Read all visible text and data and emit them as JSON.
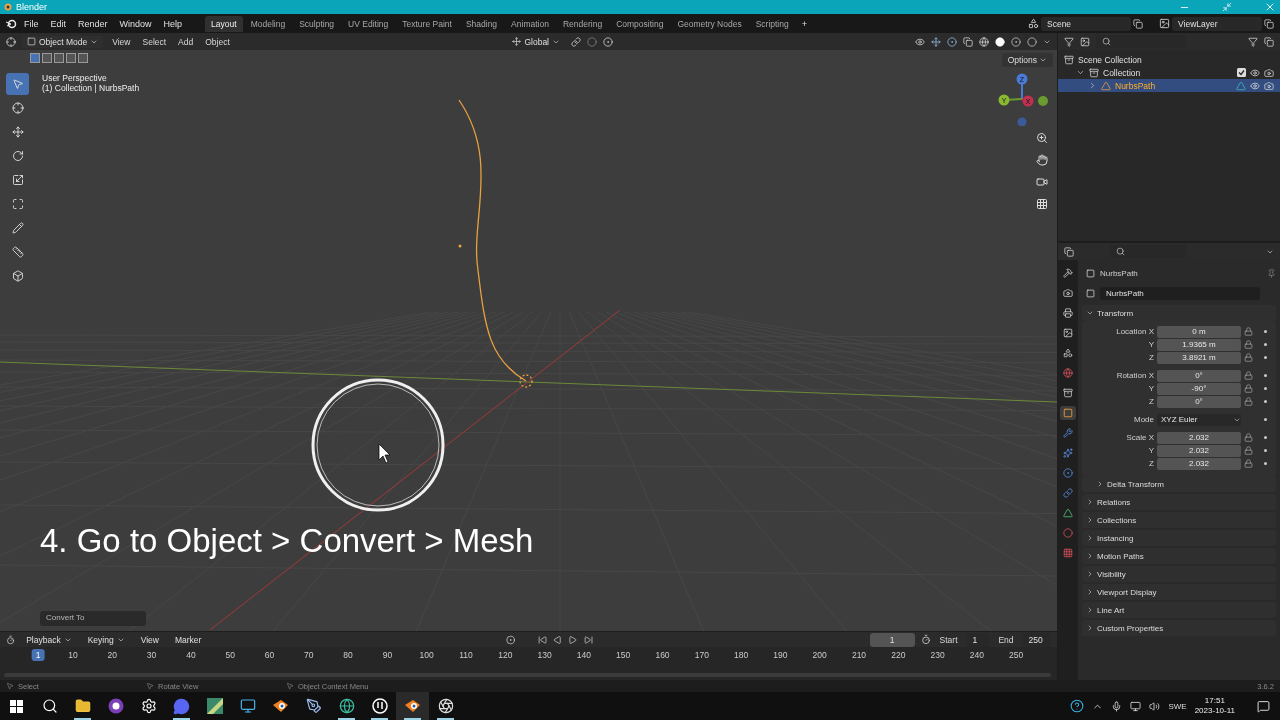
{
  "window": {
    "title": "Blender"
  },
  "menu": [
    "File",
    "Edit",
    "Render",
    "Window",
    "Help"
  ],
  "workspaces": [
    {
      "label": "Layout",
      "selected": true
    },
    {
      "label": "Modeling",
      "selected": false
    },
    {
      "label": "Sculpting",
      "selected": false
    },
    {
      "label": "UV Editing",
      "selected": false
    },
    {
      "label": "Texture Paint",
      "selected": false
    },
    {
      "label": "Shading",
      "selected": false
    },
    {
      "label": "Animation",
      "selected": false
    },
    {
      "label": "Rendering",
      "selected": false
    },
    {
      "label": "Compositing",
      "selected": false
    },
    {
      "label": "Geometry Nodes",
      "selected": false
    },
    {
      "label": "Scripting",
      "selected": false
    }
  ],
  "add_workspace": "+",
  "scene": "Scene",
  "view_layer": "ViewLayer",
  "viewport": {
    "mode": "Object Mode",
    "menus": [
      "View",
      "Select",
      "Add",
      "Object"
    ],
    "orientation": "Global",
    "options": "Options",
    "view_name": "User Perspective",
    "context": "(1) Collection | NurbsPath",
    "caption": "4. Go to Object > Convert > Mesh",
    "last_operator": "Convert To",
    "gizmo": [
      "Z",
      "Y",
      "X"
    ],
    "tools": [
      {
        "kind": "select",
        "selected": true
      },
      {
        "kind": "cursor",
        "selected": false
      },
      {
        "kind": "move",
        "selected": false
      },
      {
        "kind": "rotate",
        "selected": false
      },
      {
        "kind": "scale",
        "selected": false
      },
      {
        "kind": "transform",
        "selected": false
      },
      {
        "kind": "annotate",
        "selected": false
      },
      {
        "kind": "measure",
        "selected": false
      },
      {
        "kind": "add",
        "selected": false
      }
    ]
  },
  "outliner": {
    "items": [
      {
        "label": "Scene Collection",
        "kind": "scene",
        "children": [
          {
            "label": "Collection",
            "kind": "collection",
            "expanded": true,
            "selected": false,
            "children": [
              {
                "label": "NurbsPath",
                "kind": "object",
                "expanded": false,
                "selected": true
              }
            ]
          }
        ]
      }
    ]
  },
  "properties": {
    "object": "NurbsPath",
    "data_name": "NurbsPath",
    "panel": "Transform",
    "panel_expanded": true,
    "tabs": [
      {
        "kind": "tool",
        "selected": false
      },
      {
        "kind": "render",
        "selected": false
      },
      {
        "kind": "output",
        "selected": false
      },
      {
        "kind": "view_layer",
        "selected": false
      },
      {
        "kind": "scene",
        "selected": false
      },
      {
        "kind": "world",
        "selected": false
      },
      {
        "kind": "collection",
        "selected": false
      },
      {
        "kind": "object",
        "selected": true
      },
      {
        "kind": "modifiers",
        "selected": false
      },
      {
        "kind": "particles",
        "selected": false
      },
      {
        "kind": "physics",
        "selected": false
      },
      {
        "kind": "constraints",
        "selected": false
      },
      {
        "kind": "data",
        "selected": false
      },
      {
        "kind": "material",
        "selected": false
      },
      {
        "kind": "texture",
        "selected": false
      }
    ],
    "rows": [
      {
        "kind": "number",
        "label": "Location X",
        "value": "0 m",
        "group_start": true
      },
      {
        "kind": "number",
        "label": "Y",
        "value": "1.9365 m",
        "group_start": false
      },
      {
        "kind": "number",
        "label": "Z",
        "value": "3.8921 m",
        "group_start": false
      },
      {
        "kind": "number",
        "label": "Rotation X",
        "value": "0°",
        "group_start": true
      },
      {
        "kind": "number",
        "label": "Y",
        "value": "-90°",
        "group_start": false
      },
      {
        "kind": "number",
        "label": "Z",
        "value": "0°",
        "group_start": false
      },
      {
        "kind": "select",
        "label": "Mode",
        "value": "XYZ Euler",
        "group_start": true
      },
      {
        "kind": "number",
        "label": "Scale X",
        "value": "2.032",
        "group_start": true
      },
      {
        "kind": "number",
        "label": "Y",
        "value": "2.032",
        "group_start": false
      },
      {
        "kind": "number",
        "label": "Z",
        "value": "2.032",
        "group_start": false
      }
    ],
    "sections": [
      {
        "label": "Delta Transform",
        "kind": "subpanel",
        "expanded": false
      },
      {
        "label": "Relations",
        "kind": "panel",
        "expanded": false
      },
      {
        "label": "Collections",
        "kind": "panel",
        "expanded": false
      },
      {
        "label": "Instancing",
        "kind": "panel",
        "expanded": false
      },
      {
        "label": "Motion Paths",
        "kind": "panel",
        "expanded": false
      },
      {
        "label": "Visibility",
        "kind": "panel",
        "expanded": false
      },
      {
        "label": "Viewport Display",
        "kind": "panel",
        "expanded": false
      },
      {
        "label": "Line Art",
        "kind": "panel",
        "expanded": false
      },
      {
        "label": "Custom Properties",
        "kind": "panel",
        "expanded": false
      }
    ]
  },
  "timeline": {
    "menus": [
      "Playback",
      "Keying",
      "View",
      "Marker"
    ],
    "frame_field": "1",
    "start_label": "Start",
    "start": "1",
    "end_label": "End",
    "end": "250",
    "playhead": "1",
    "frames": [
      "10",
      "20",
      "30",
      "40",
      "50",
      "60",
      "70",
      "80",
      "90",
      "100",
      "110",
      "120",
      "130",
      "140",
      "150",
      "160",
      "170",
      "180",
      "190",
      "200",
      "210",
      "220",
      "230",
      "240",
      "250"
    ]
  },
  "status_bar": {
    "hints": [
      "Select",
      "Rotate View",
      "Object Context Menu"
    ],
    "version": "3.6.2"
  },
  "taskbar": {
    "apps": [
      {
        "kind": "start",
        "running": false
      },
      {
        "kind": "search",
        "running": false
      },
      {
        "kind": "folder",
        "running": true
      },
      {
        "kind": "cat",
        "running": false
      },
      {
        "kind": "settings",
        "running": false
      },
      {
        "kind": "chat",
        "running": true
      },
      {
        "kind": "map",
        "running": false
      },
      {
        "kind": "monitor",
        "running": false
      },
      {
        "kind": "blender",
        "running": false
      },
      {
        "kind": "pen",
        "running": false
      },
      {
        "kind": "globe",
        "running": true
      },
      {
        "kind": "unreal",
        "running": true
      },
      {
        "kind": "blender",
        "running": true
      },
      {
        "kind": "aperture",
        "running": true
      }
    ],
    "language": "SWE",
    "time": "17:51",
    "date": "2023-10-11"
  }
}
